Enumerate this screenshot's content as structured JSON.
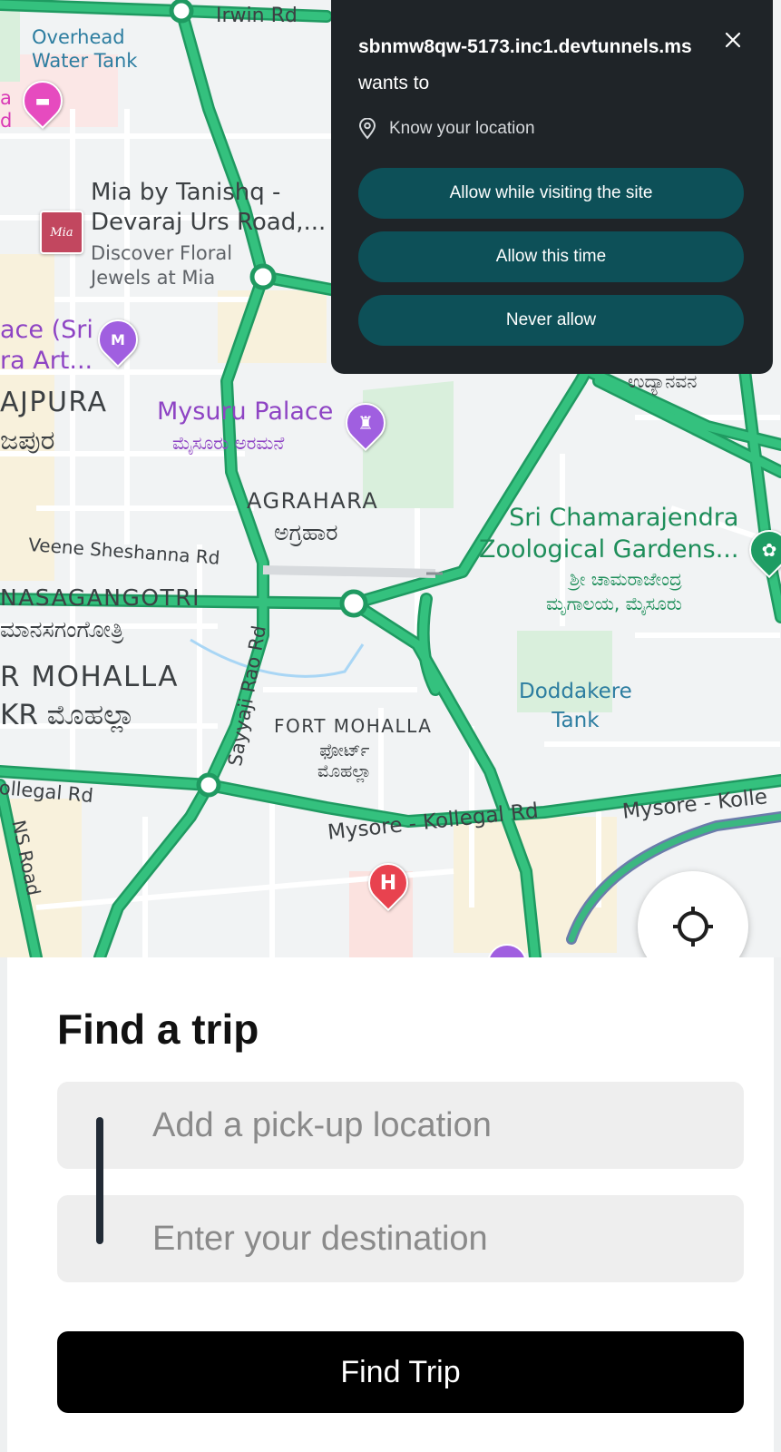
{
  "map": {
    "labels": {
      "irwin_rd": "Irwin Rd",
      "overhead_water_tank": "Overhead\nWater Tank",
      "pink_poi_fragment": "a\nd",
      "mia_title": "Mia by Tanishq -\nDevaraj Urs Road,...",
      "mia_sub": "Discover Floral\nJewels at Mia",
      "ace_fragment": "ace (Sri\nra Art...",
      "ajpura": "AJPURA",
      "ajpura_kn": "ಜಪುರ",
      "mysuru_palace": "Mysuru Palace",
      "mysuru_palace_kn": "ಮೈಸೂರು ಅರಮನೆ",
      "agrahara": "AGRAHARA",
      "agrahara_kn": "ಅಗ್ರಹಾರ",
      "veene_rd": "Veene Sheshanna Rd",
      "nasagangotri": "NASAGANGOTRI",
      "nasagangotri_kn": "ಮಾನಸಗಂಗೋತ್ರಿ",
      "r_mohalla": "R MOHALLA",
      "kr_mohalla_kn": "KR ಮೊಹಲ್ಲಾ",
      "sayyaji_rao_rd": "Sayyaji Rao Rd",
      "fort_mohalla": "FORT MOHALLA",
      "fort_mohalla_kn": "ಫೋರ್ಟ್\nಮೊಹಲ್ಲಾ",
      "udyanavana_kn": "ಉದ್ಯಾನವನ",
      "zoo_name": "Sri Chamarajendra\nZoological Gardens...",
      "zoo_kn": "ಶ್ರೀ ಚಾಮರಾಜೇಂದ್ರ\nಮೃಗಾಲಯ, ಮೈಸೂರು",
      "doddakere": "Doddakere\nTank",
      "kollegal_rd_left": "ollegal Rd",
      "ns_road": "NS Road",
      "mysore_kollegal_rd": "Mysore - Kollegal Rd",
      "mysore_kolle": "Mysore - Kolle",
      "hospital_glyph": "H",
      "museum_glyph": "M"
    },
    "locate_button_icon": "crosshair-icon"
  },
  "permission_popup": {
    "site": "sbnmw8qw-5173.inc1.devtunnels.ms",
    "wants_to": "wants to",
    "permission": "Know your location",
    "buttons": [
      "Allow while visiting the site",
      "Allow this time",
      "Never allow"
    ],
    "close_icon": "close-icon"
  },
  "trip": {
    "title": "Find a trip",
    "pickup_placeholder": "Add a pick-up location",
    "destination_placeholder": "Enter your destination",
    "submit_label": "Find Trip"
  },
  "colors": {
    "road_traffic": "#34c17e",
    "popup_bg": "#1f2428",
    "popup_button": "#0d5058",
    "palace_purple": "#8e44c4",
    "zoo_green": "#1e8e5a",
    "hospital_red": "#e8424f"
  }
}
